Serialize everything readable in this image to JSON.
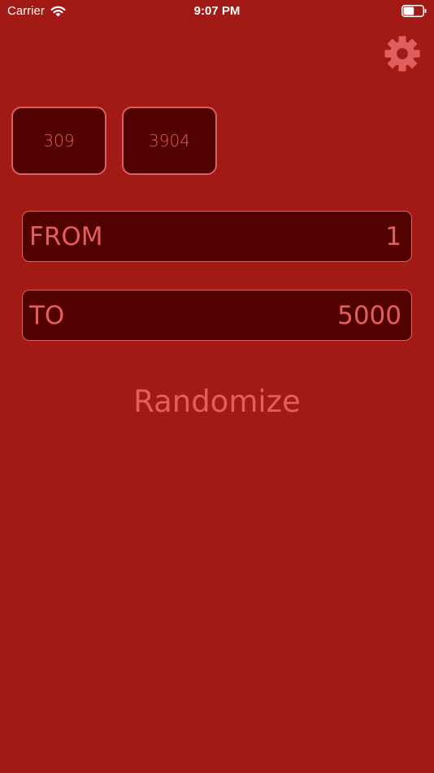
{
  "status_bar": {
    "carrier": "Carrier",
    "time": "9:07 PM"
  },
  "results": [
    "309",
    "3904"
  ],
  "range": {
    "from_label": "FROM",
    "from_value": "1",
    "to_label": "TO",
    "to_value": "5000"
  },
  "randomize_label": "Randomize",
  "icons": {
    "settings": "gear-icon",
    "wifi": "wifi-icon",
    "battery": "battery-icon"
  },
  "colors": {
    "background": "#a21a16",
    "field_background": "#520101",
    "accent": "#e25e5f",
    "status_text": "#ffffff"
  },
  "battery_level": 0.55
}
